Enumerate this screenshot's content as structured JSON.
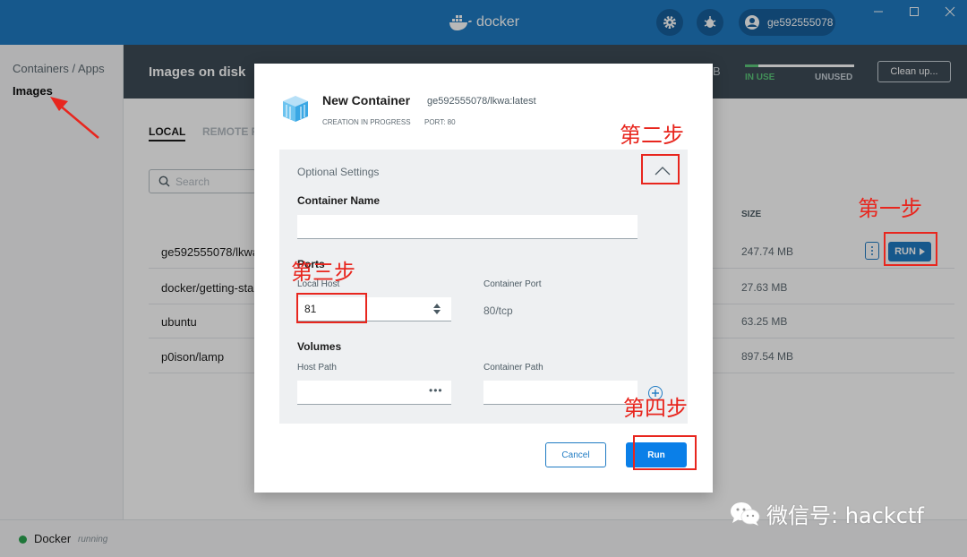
{
  "titlebar": {
    "app_name": "docker",
    "user": "ge592555078"
  },
  "sidebar": {
    "items": [
      {
        "label": "Containers / Apps"
      },
      {
        "label": "Images"
      }
    ]
  },
  "header": {
    "title": "Images on disk",
    "usage_size_fragment": "B",
    "usage_fraction": 0.12,
    "in_use_label": "IN USE",
    "unused_label": "UNUSED",
    "cleanup_label": "Clean up..."
  },
  "tabs": {
    "local": "LOCAL",
    "remote": "REMOTE R"
  },
  "search": {
    "placeholder": "Search"
  },
  "table": {
    "size_header": "SIZE",
    "rows": [
      {
        "name": "ge592555078/lkwa",
        "size": "247.74 MB"
      },
      {
        "name": "docker/getting-sta",
        "size": "27.63 MB"
      },
      {
        "name": "ubuntu",
        "size": "63.25 MB"
      },
      {
        "name": "p0ison/lamp",
        "size": "897.54 MB"
      }
    ],
    "run_label": "RUN"
  },
  "footer": {
    "name": "Docker",
    "state": "running"
  },
  "modal": {
    "title": "New Container",
    "image": "ge592555078/lkwa:latest",
    "status": "CREATION IN PROGRESS",
    "port": "PORT: 80",
    "optional_settings": "Optional Settings",
    "container_name_label": "Container Name",
    "container_name_value": "",
    "ports_label": "Ports",
    "local_host_label": "Local Host",
    "local_host_value": "81",
    "container_port_label": "Container Port",
    "container_port_value": "80/tcp",
    "volumes_label": "Volumes",
    "host_path_label": "Host Path",
    "host_path_value": "",
    "container_path_label": "Container Path",
    "container_path_value": "",
    "cancel_label": "Cancel",
    "run_label": "Run"
  },
  "annotations": {
    "step1": "第一步",
    "step2": "第二步",
    "step3": "第三步",
    "step4": "第四步",
    "color": "#e8261e"
  },
  "watermark": {
    "text": "微信号: hackctf"
  }
}
